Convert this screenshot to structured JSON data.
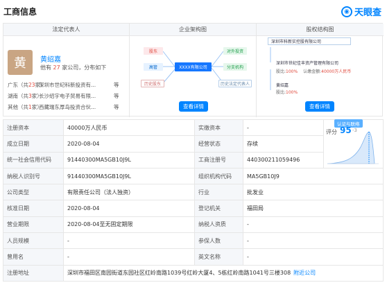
{
  "header": {
    "title": "工商信息",
    "brand": "天眼查",
    "brand_icon": "eye-logo-icon"
  },
  "legal": {
    "tab": "法定代表人",
    "avatar_char": "黄",
    "name": "黄绍嘉",
    "prefix": "他有",
    "count": "27",
    "suffix": "家公司，分布如下",
    "regions": [
      {
        "name": "广东",
        "prefix": "（共",
        "count": "23",
        "suffix": "家）",
        "company": "深圳市世纪科新投资有...",
        "more": "等"
      },
      {
        "name": "湖南",
        "prefix": "（共",
        "count": "3",
        "suffix": "家）",
        "company": "长沙绍宇电子贸易有限...",
        "more": "等"
      },
      {
        "name": "其他",
        "prefix": "（共",
        "count": "1",
        "suffix": "家）",
        "company": "西藏瑞东厚岛投资合伙...",
        "more": "等"
      }
    ],
    "button": "查看详情"
  },
  "structure": {
    "tab": "企业架构图",
    "nodes": {
      "shareholder": "股东",
      "exec": "高管",
      "center": "XXXX有限公司",
      "invest": "对外投资",
      "branch": "分支机构",
      "hist_holder": "历史股东",
      "hist_rep": "历史法定代表人"
    },
    "button": "查看详情"
  },
  "equity": {
    "tab": "股权结构图",
    "top": "深圳市科新实控股有限公司",
    "l2": "深圳市世纪佳丰资产管理有限公司",
    "ratio_label": "股比:",
    "ratio": "100%",
    "amount_label": "认缴金额:",
    "amount": "40000万人民币",
    "l3": "黄绍嘉",
    "l3_ratio_label": "股比:",
    "l3_ratio": "100%",
    "button": "查看详情"
  },
  "score": {
    "badge": "认证与联络",
    "label": "评分",
    "value": "95",
    "delta": "-3"
  },
  "rows": [
    [
      {
        "l": "注册资本",
        "v": "40000万人民币"
      },
      {
        "l": "实缴资本",
        "v": "-"
      }
    ],
    [
      {
        "l": "成立日期",
        "v": "2020-08-04"
      },
      {
        "l": "经营状态",
        "v": "存续"
      }
    ],
    [
      {
        "l": "统一社会信用代码",
        "v": "91440300MA5GB10J9L"
      },
      {
        "l": "工商注册号",
        "v": "440300211059496"
      }
    ],
    [
      {
        "l": "纳税人识别号",
        "v": "91440300MA5GB10J9L"
      },
      {
        "l": "组织机构代码",
        "v": "MA5GB10J9"
      }
    ],
    [
      {
        "l": "公司类型",
        "v": "有限责任公司（法人独资）"
      },
      {
        "l": "行业",
        "v": "批发业"
      }
    ],
    [
      {
        "l": "核准日期",
        "v": "2020-08-04"
      },
      {
        "l": "登记机关",
        "v": "福田局"
      }
    ],
    [
      {
        "l": "营业期限",
        "v": "2020-08-04至无固定期限"
      },
      {
        "l": "纳税人资质",
        "v": "-"
      }
    ],
    [
      {
        "l": "人员规模",
        "v": "-"
      },
      {
        "l": "参保人数",
        "v": "-"
      }
    ],
    [
      {
        "l": "曾用名",
        "v": "-"
      },
      {
        "l": "英文名称",
        "v": "-"
      }
    ]
  ],
  "address": {
    "label": "注册地址",
    "value": "深圳市福田区南园街道东园社区红岭南路1039号红岭大厦4、5栋红岭南路1041号三楼308",
    "link": "附近公司"
  },
  "colors": {
    "accent": "#0084ff",
    "red": "#e0493d",
    "label_bg": "#f5f7fa"
  }
}
